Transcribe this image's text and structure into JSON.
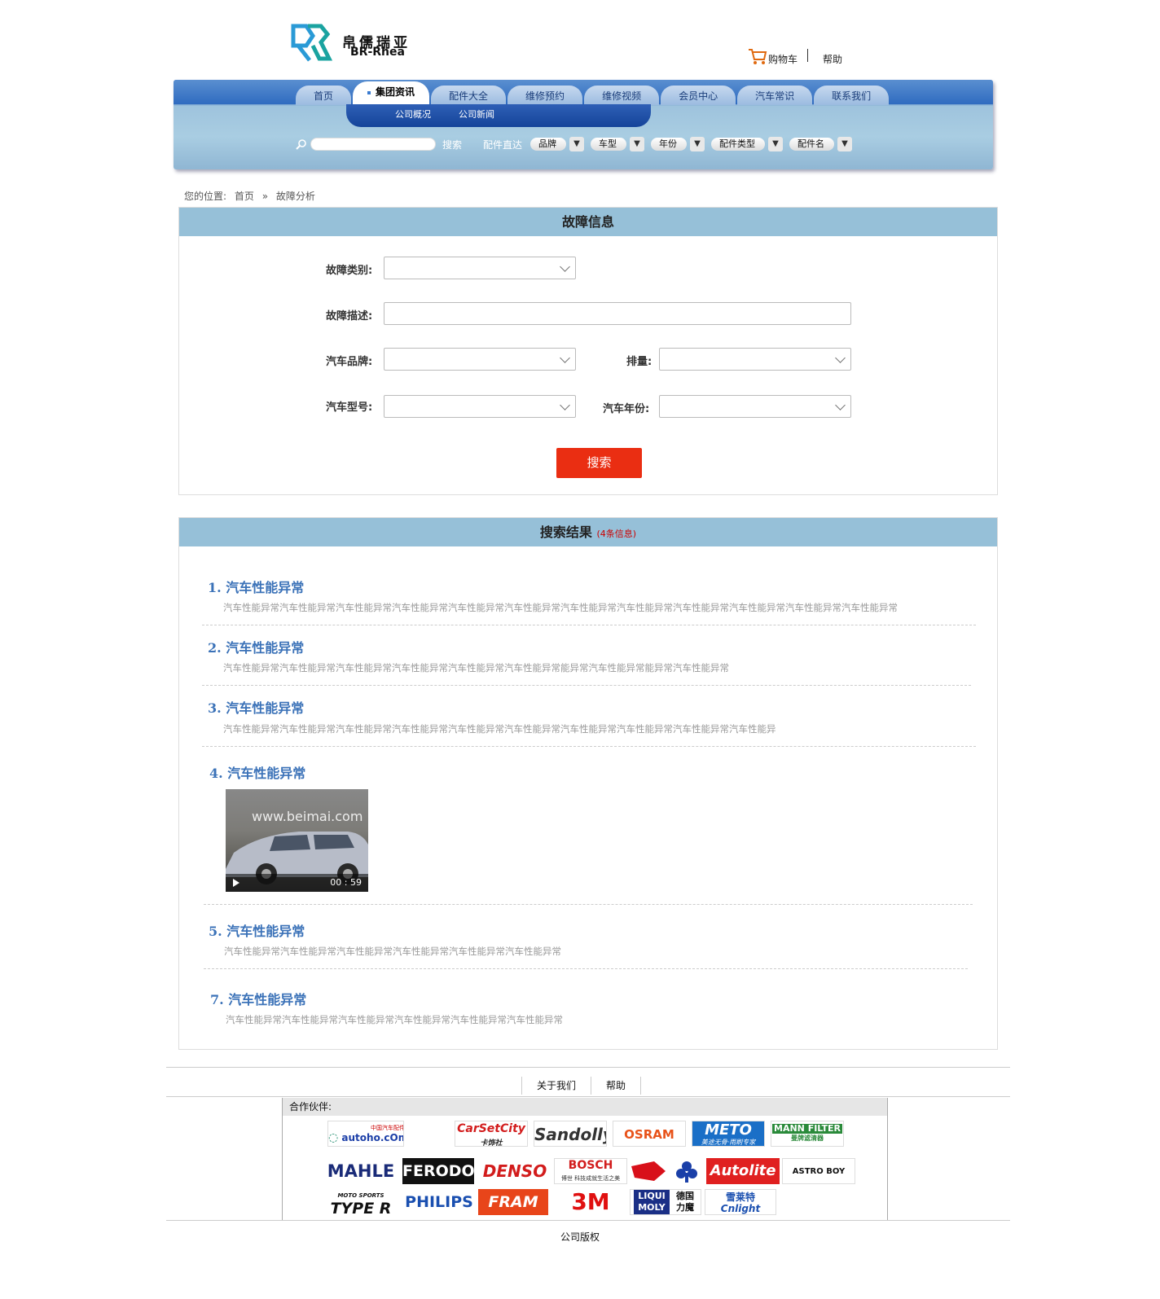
{
  "header": {
    "logo_cn": "帛儒瑞亚",
    "logo_en": "BR-Rhea",
    "cart_label": "购物车",
    "help_label": "帮助"
  },
  "nav": {
    "tabs": [
      {
        "label": "首页"
      },
      {
        "label": "集团资讯",
        "active": true
      },
      {
        "label": "配件大全"
      },
      {
        "label": "维修预约"
      },
      {
        "label": "维修视频"
      },
      {
        "label": "会员中心"
      },
      {
        "label": "汽车常识"
      },
      {
        "label": "联系我们"
      }
    ],
    "subnav": [
      "公司概况",
      "公司新闻"
    ],
    "search_label": "搜索",
    "direct_label": "配件直达",
    "dropdowns": [
      "品牌",
      "车型",
      "年份",
      "配件类型",
      "配件名"
    ]
  },
  "breadcrumb": {
    "prefix": "您的位置:",
    "home": "首页",
    "sep": "»",
    "current": "故障分析"
  },
  "fault_form": {
    "title": "故障信息",
    "category_label": "故障类别:",
    "description_label": "故障描述:",
    "brand_label": "汽车品牌:",
    "displacement_label": "排量:",
    "model_label": "汽车型号:",
    "year_label": "汽车年份:",
    "submit_label": "搜索"
  },
  "results": {
    "title": "搜索结果",
    "count_text": "(4条信息)",
    "items": [
      {
        "num": "1.",
        "title": "汽车性能异常",
        "desc": "汽车性能异常汽车性能异常汽车性能异常汽车性能异常汽车性能异常汽车性能异常汽车性能异常汽车性能异常汽车性能异常汽车性能异常汽车性能异常汽车性能异常"
      },
      {
        "num": "2.",
        "title": "汽车性能异常",
        "desc": "汽车性能异常汽车性能异常汽车性能异常汽车性能异常汽车性能异常汽车性能异常能异常汽车性能异常能异常汽车性能异常"
      },
      {
        "num": "3.",
        "title": "汽车性能异常",
        "desc": "汽车性能异常汽车性能异常汽车性能异常汽车性能异常汽车性能异常汽车性能异常汽车性能异常汽车性能异常汽车性能异常汽车性能异"
      },
      {
        "num": "4.",
        "title": "汽车性能异常",
        "video": {
          "watermark": "www.beimai.com",
          "duration": "00 : 59"
        }
      },
      {
        "num": "5.",
        "title": "汽车性能异常",
        "desc": "汽车性能异常汽车性能异常汽车性能异常汽车性能异常汽车性能异常汽车性能异常"
      },
      {
        "num": "7.",
        "title": "汽车性能异常",
        "desc": "汽车性能异常汽车性能异常汽车性能异常汽车性能异常汽车性能异常汽车性能异常"
      }
    ]
  },
  "footer": {
    "links": [
      "关于我们",
      "帮助"
    ],
    "partners_label": "合作伙伴:",
    "partners": [
      "autoho.cOm",
      "CarSetCity",
      "Sandolly",
      "OSRAM",
      "METO",
      "MANN FILTER",
      "MAHLE",
      "FERODO",
      "DENSO",
      "BOSCH",
      "Autolite",
      "ASTRO BOY",
      "TYPE R",
      "PHILIPS",
      "FRAM",
      "3M",
      "LIQUI MOLY",
      "Cnlight"
    ],
    "partner_subtexts": [
      "中国汽车配件网",
      "卡饰社",
      "美途无骨·雨刷专家",
      "曼牌滤清器",
      "博世 科技成就生活之美",
      "德国 力魔",
      "雪莱特",
      "MOTO SPORTS"
    ],
    "copyright": "公司版权"
  },
  "colors": {
    "nav_blue": "#2f6bc0",
    "panel_head": "#96c0d8",
    "search_button": "#ea2e12",
    "result_title": "#3b72b8"
  }
}
